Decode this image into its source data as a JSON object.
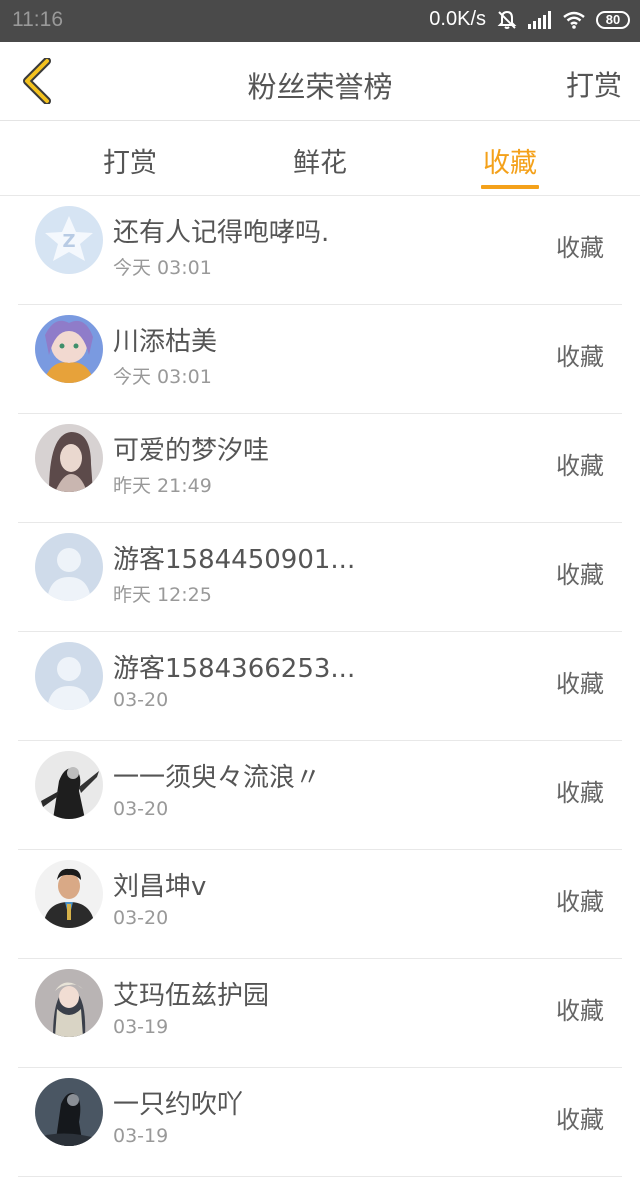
{
  "status": {
    "time": "11:16",
    "net_speed": "0.0K/s",
    "battery": "80",
    "icons": [
      "bell-off-icon",
      "signal-icon",
      "wifi-icon",
      "battery-icon"
    ]
  },
  "header": {
    "title": "粉丝荣誉榜",
    "right_label": "打赏",
    "back_icon": "chevron-left-icon",
    "accent": "#f4a11a"
  },
  "tabs": [
    {
      "label": "打赏",
      "active": false
    },
    {
      "label": "鲜花",
      "active": false
    },
    {
      "label": "收藏",
      "active": true
    }
  ],
  "items": [
    {
      "name": "还有人记得咆哮吗.",
      "time": "今天 03:01",
      "action": "收藏",
      "avatar": "qq-default-avatar"
    },
    {
      "name": "川添枯美",
      "time": "今天 03:01",
      "action": "收藏",
      "avatar": "anime-girl-avatar"
    },
    {
      "name": "可爱的梦汐哇",
      "time": "昨天 21:49",
      "action": "收藏",
      "avatar": "girl-photo-avatar"
    },
    {
      "name": "游客1584450901...",
      "time": "昨天 12:25",
      "action": "收藏",
      "avatar": "default-user-avatar"
    },
    {
      "name": "游客1584366253...",
      "time": "03-20",
      "action": "收藏",
      "avatar": "default-user-avatar"
    },
    {
      "name": "一一须臾々流浪〃",
      "time": "03-20",
      "action": "收藏",
      "avatar": "dark-figure-avatar"
    },
    {
      "name": "刘昌坤v",
      "time": "03-20",
      "action": "收藏",
      "avatar": "man-photo-avatar"
    },
    {
      "name": "艾玛伍兹护园",
      "time": "03-19",
      "action": "收藏",
      "avatar": "anime-character-avatar"
    },
    {
      "name": "一只约吹吖",
      "time": "03-19",
      "action": "收藏",
      "avatar": "dark-figure-avatar"
    }
  ]
}
